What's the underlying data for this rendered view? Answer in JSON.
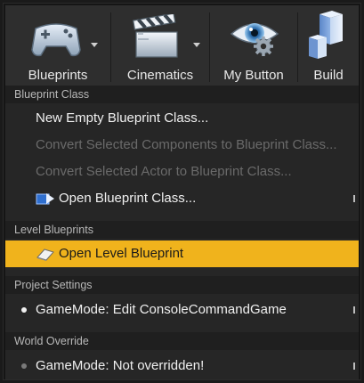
{
  "toolbar": {
    "buttons": [
      {
        "label": "Blueprints",
        "icon": "gamepad-icon",
        "has_dropdown": true
      },
      {
        "label": "Cinematics",
        "icon": "clapperboard-icon",
        "has_dropdown": true
      },
      {
        "label": "My Button",
        "icon": "eye-gear-icon",
        "has_dropdown": false
      },
      {
        "label": "Build",
        "icon": "cubes-icon",
        "has_dropdown": false
      }
    ]
  },
  "menu": {
    "sections": [
      {
        "header": "Blueprint Class",
        "items": [
          {
            "label": "New Empty Blueprint Class...",
            "enabled": true
          },
          {
            "label": "Convert Selected Components to Blueprint Class...",
            "enabled": false
          },
          {
            "label": "Convert Selected Actor to Blueprint Class...",
            "enabled": false
          },
          {
            "label": "Open Blueprint Class...",
            "enabled": true,
            "icon": "open-blueprint-icon",
            "has_submenu": true
          }
        ]
      },
      {
        "header": "Level Blueprints",
        "items": [
          {
            "label": "Open Level Blueprint",
            "enabled": true,
            "icon": "level-blueprint-icon",
            "highlighted": true
          }
        ]
      },
      {
        "header": "Project Settings",
        "items": [
          {
            "label": "GameMode: Edit ConsoleCommandGame",
            "enabled": true,
            "bullet": true,
            "has_submenu": true
          }
        ]
      },
      {
        "header": "World Override",
        "items": [
          {
            "label": "GameMode: Not overridden!",
            "enabled": true,
            "bullet": true,
            "bullet_dim": true,
            "has_submenu": true
          }
        ]
      }
    ]
  },
  "colors": {
    "highlight": "#f0b31c",
    "toolbar_bg": "#2e2e2e",
    "menu_bg": "#262626"
  }
}
